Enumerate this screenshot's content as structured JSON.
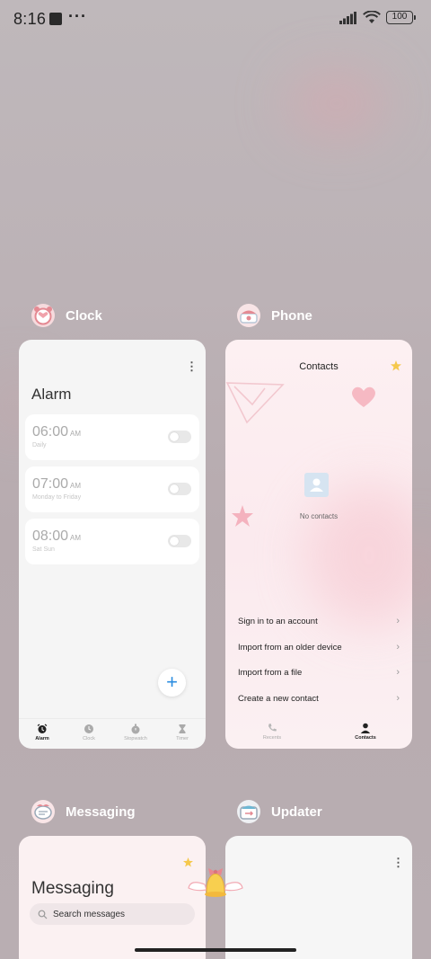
{
  "status_bar": {
    "time": "8:16",
    "dots": "···",
    "battery": "100"
  },
  "recents": [
    {
      "app": "Clock",
      "icon": "alarm-clock-icon"
    },
    {
      "app": "Phone",
      "icon": "phone-icon"
    },
    {
      "app": "Messaging",
      "icon": "messaging-icon"
    },
    {
      "app": "Updater",
      "icon": "updater-icon"
    }
  ],
  "clock": {
    "menu": "⋮",
    "title": "Alarm",
    "alarms": [
      {
        "time": "06:00",
        "ampm": "AM",
        "repeat": "Daily",
        "enabled": false
      },
      {
        "time": "07:00",
        "ampm": "AM",
        "repeat": "Monday to Friday",
        "enabled": false
      },
      {
        "time": "08:00",
        "ampm": "AM",
        "repeat": "Sat Sun",
        "enabled": false
      }
    ],
    "add": "+",
    "tabs": [
      "Alarm",
      "Clock",
      "Stopwatch",
      "Timer"
    ]
  },
  "phone": {
    "title": "Contacts",
    "empty": "No contacts",
    "actions": [
      "Sign in to an account",
      "Import from an older device",
      "Import from a file",
      "Create a new contact"
    ],
    "tabs": [
      "Recents",
      "Contacts"
    ],
    "chevron": "›"
  },
  "messaging": {
    "title": "Messaging",
    "search_placeholder": "Search messages"
  },
  "updater": {
    "menu": "⋮"
  }
}
